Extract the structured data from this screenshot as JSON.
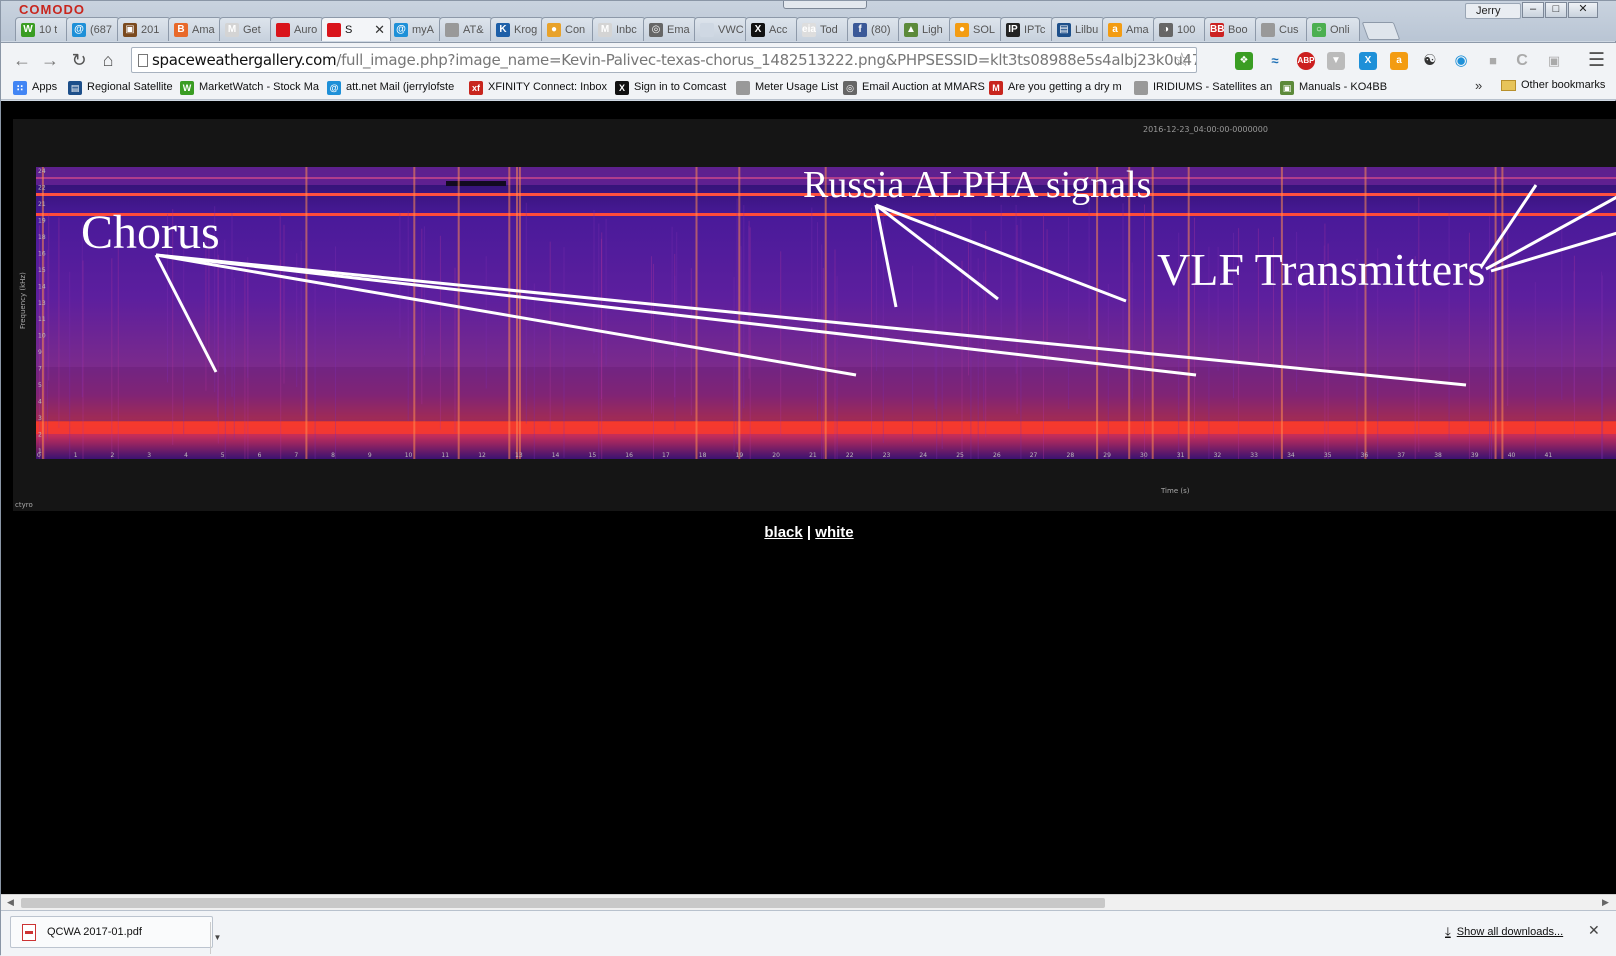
{
  "browser": {
    "brand": "COMODO",
    "user": "Jerry",
    "tabs": [
      {
        "label": "10 t",
        "color": "#3a9d23",
        "glyph": "W"
      },
      {
        "label": "(687",
        "color": "#1e90d8",
        "glyph": "@"
      },
      {
        "label": "201",
        "color": "#7b4a1e",
        "glyph": "▣"
      },
      {
        "label": "Ama",
        "color": "#e8692a",
        "glyph": "B"
      },
      {
        "label": "Get",
        "color": "#d4d4d4",
        "glyph": "M"
      },
      {
        "label": "Auro",
        "color": "#d9141b",
        "glyph": ""
      },
      {
        "label": "S",
        "color": "#d9141b",
        "glyph": "",
        "active": true
      },
      {
        "label": "myA",
        "color": "#1e90d8",
        "glyph": "@"
      },
      {
        "label": "AT&",
        "color": "#999999",
        "glyph": ""
      },
      {
        "label": "Krog",
        "color": "#1d5fa8",
        "glyph": "K"
      },
      {
        "label": "Con",
        "color": "#e8a22a",
        "glyph": "●"
      },
      {
        "label": "Inbc",
        "color": "#d4d4d4",
        "glyph": "M"
      },
      {
        "label": "Ema",
        "color": "#666666",
        "glyph": "◎"
      },
      {
        "label": "VWC",
        "color": "#cfd8e3",
        "glyph": ""
      },
      {
        "label": "Acc",
        "color": "#111111",
        "glyph": "X"
      },
      {
        "label": "Tod",
        "color": "#dddddd",
        "glyph": "eia"
      },
      {
        "label": "(80)",
        "color": "#3b5998",
        "glyph": "f"
      },
      {
        "label": "Ligh",
        "color": "#5c8a3a",
        "glyph": "▲"
      },
      {
        "label": "SOL",
        "color": "#f39c12",
        "glyph": "●"
      },
      {
        "label": "IPTc",
        "color": "#222222",
        "glyph": "IP"
      },
      {
        "label": "Lilbu",
        "color": "#1d4f8a",
        "glyph": "▤"
      },
      {
        "label": "Ama",
        "color": "#f39c12",
        "glyph": "a"
      },
      {
        "label": "100",
        "color": "#666666",
        "glyph": "◑"
      },
      {
        "label": "Boo",
        "color": "#cc2222",
        "glyph": "BB"
      },
      {
        "label": "Cus",
        "color": "#999999",
        "glyph": ""
      },
      {
        "label": "Onli",
        "color": "#4caf50",
        "glyph": "○"
      }
    ],
    "url_host": "spaceweathergallery.com",
    "url_path": "/full_image.php?image_name=Kevin-Palivec-texas-chorus_1482513222.png&PHPSESSID=klt3ts08988e5s4albj23k0u47",
    "bookmarks": [
      {
        "label": "Apps",
        "color": "#4285f4",
        "glyph": "∷"
      },
      {
        "label": "Regional Satellite",
        "color": "#1d4f8a",
        "glyph": "▤"
      },
      {
        "label": "MarketWatch - Stock Ma",
        "color": "#3a9d23",
        "glyph": "W"
      },
      {
        "label": "att.net Mail (jerrylofste",
        "color": "#1e90d8",
        "glyph": "@"
      },
      {
        "label": "XFINITY Connect: Inbox",
        "color": "#c8261e",
        "glyph": "xf"
      },
      {
        "label": "Sign in to Comcast",
        "color": "#111111",
        "glyph": "X"
      },
      {
        "label": "Meter Usage List",
        "color": "#999999",
        "glyph": ""
      },
      {
        "label": "Email Auction at MMARS",
        "color": "#666666",
        "glyph": "◎"
      },
      {
        "label": "Are you getting a dry m",
        "color": "#c8261e",
        "glyph": "M"
      },
      {
        "label": "IRIDIUMS - Satellites an",
        "color": "#999999",
        "glyph": ""
      },
      {
        "label": "Manuals - KO4BB",
        "color": "#5c8a3a",
        "glyph": "▣"
      }
    ],
    "bookmarks_more": "»",
    "other_bookmarks": "Other bookmarks"
  },
  "page": {
    "annotations": {
      "chorus": "Chorus",
      "russia": "Russia ALPHA signals",
      "vlf": "VLF Transmitters"
    },
    "plot_timestamp": "2016-12-23_04:00:00-0000000",
    "ylabel": "Frequency (kHz)",
    "xlabel": "Time (s)",
    "corner_label": "ctyro",
    "y_ticks": [
      "24",
      "22",
      "21",
      "19",
      "18",
      "16",
      "15",
      "14",
      "13",
      "11",
      "10",
      "9",
      "7",
      "5",
      "4",
      "3",
      "2",
      "1"
    ],
    "x_ticks": [
      "0",
      "1",
      "2",
      "3",
      "4",
      "5",
      "6",
      "7",
      "8",
      "9",
      "10",
      "11",
      "12",
      "13",
      "14",
      "15",
      "16",
      "17",
      "18",
      "19",
      "20",
      "21",
      "22",
      "23",
      "24",
      "25",
      "26",
      "27",
      "28",
      "29",
      "30",
      "31",
      "32",
      "33",
      "34",
      "35",
      "36",
      "37",
      "38",
      "39",
      "40",
      "41"
    ],
    "link_black": "black",
    "link_separator": "|",
    "link_white": "white"
  },
  "downloads": {
    "file": "QCWA 2017-01.pdf",
    "show_all": "Show all downloads..."
  }
}
